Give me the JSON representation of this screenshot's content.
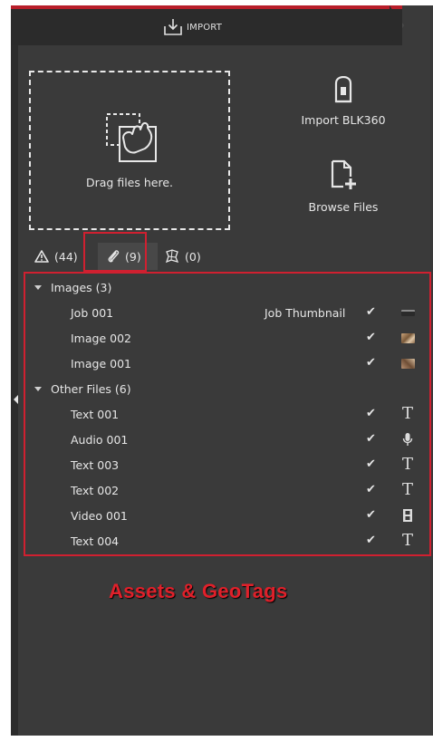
{
  "header": {
    "title": "IMPORT",
    "icon": "import-tray-icon"
  },
  "drop_zone": {
    "text": "Drag files here.",
    "icon": "drag-hand-icon"
  },
  "actions": {
    "import_blk360": {
      "label": "Import BLK360",
      "icon": "blk360-device-icon"
    },
    "browse_files": {
      "label": "Browse Files",
      "icon": "add-file-icon"
    }
  },
  "filter_tabs": [
    {
      "icon": "warning-icon",
      "count": "(44)"
    },
    {
      "icon": "paperclip-icon",
      "count": "(9)"
    },
    {
      "icon": "geotag-icon",
      "count": "(0)"
    }
  ],
  "groups": {
    "images": {
      "label": "Images (3)",
      "items": [
        {
          "name": "Job 001",
          "extra": "Job Thumbnail",
          "check": "✔",
          "icon": "thumbnail-dark"
        },
        {
          "name": "Image 002",
          "extra": "",
          "check": "✔",
          "icon": "thumbnail-photo"
        },
        {
          "name": "Image 001",
          "extra": "",
          "check": "✔",
          "icon": "thumbnail-photo"
        }
      ]
    },
    "other_files": {
      "label": "Other Files (6)",
      "items": [
        {
          "name": "Text 001",
          "check": "✔",
          "icon": "text-icon",
          "glyph": "T"
        },
        {
          "name": "Audio 001",
          "check": "✔",
          "icon": "microphone-icon",
          "glyph": ""
        },
        {
          "name": "Text 003",
          "check": "✔",
          "icon": "text-icon",
          "glyph": "T"
        },
        {
          "name": "Text 002",
          "check": "✔",
          "icon": "text-icon",
          "glyph": "T"
        },
        {
          "name": "Video 001",
          "check": "✔",
          "icon": "film-icon",
          "glyph": ""
        },
        {
          "name": "Text 004",
          "check": "✔",
          "icon": "text-icon",
          "glyph": "T"
        }
      ]
    }
  },
  "caption": "Assets & GeoTags",
  "colors": {
    "panel": "#3a3a3a",
    "header": "#2b2b2b",
    "accent": "#b81e2a",
    "highlight": "#d02030",
    "text": "#e6e6e6"
  }
}
